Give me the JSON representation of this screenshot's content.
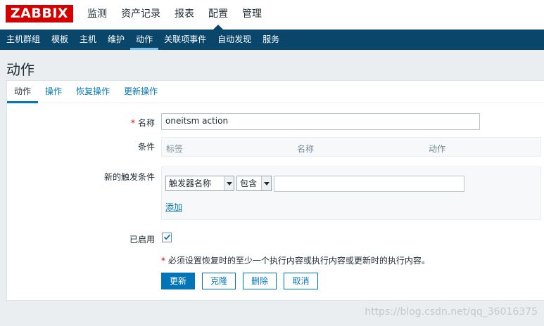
{
  "header": {
    "logo": "ZABBIX",
    "menu": [
      {
        "label": "监测"
      },
      {
        "label": "资产记录"
      },
      {
        "label": "报表"
      },
      {
        "label": "配置"
      },
      {
        "label": "管理"
      }
    ],
    "active_menu": "配置"
  },
  "subnav": {
    "items": [
      {
        "label": "主机群组"
      },
      {
        "label": "模板"
      },
      {
        "label": "主机"
      },
      {
        "label": "维护"
      },
      {
        "label": "动作"
      },
      {
        "label": "关联项事件"
      },
      {
        "label": "自动发现"
      },
      {
        "label": "服务"
      }
    ],
    "active": "动作"
  },
  "page": {
    "title": "动作"
  },
  "tabs": [
    {
      "label": "动作"
    },
    {
      "label": "操作"
    },
    {
      "label": "恢复操作"
    },
    {
      "label": "更新操作"
    }
  ],
  "form": {
    "required_mark": "*",
    "name_label": "名称",
    "name_value": "oneitsm action",
    "conditions_label": "条件",
    "conditions_headers": [
      "标签",
      "名称",
      "动作"
    ],
    "new_condition_label": "新的触发条件",
    "condition_type_value": "触发器名称",
    "condition_operator_value": "包含",
    "condition_value": "",
    "add_link": "添加",
    "enabled_label": "已启用",
    "enabled_checked": true,
    "note_mark": "*",
    "note": "必须设置恢复时的至少一个执行内容或执行内容或更新时的执行内容。",
    "buttons": {
      "update": "更新",
      "clone": "克隆",
      "delete": "删除",
      "cancel": "取消"
    }
  },
  "watermark": "https://blog.csdn.net/qq_36016375",
  "colors": {
    "brand_red": "#d40000",
    "nav_blue": "#0a466a",
    "accent_blue": "#0275b8",
    "active_underline": "#78c3f0"
  }
}
